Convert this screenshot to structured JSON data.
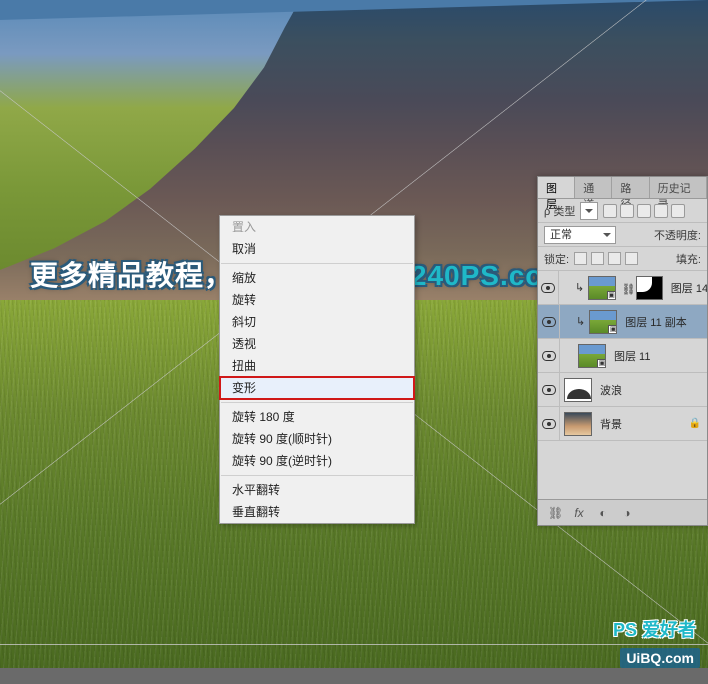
{
  "watermark": {
    "top_text": "更多精品教程，请访问",
    "url": "www.240PS.com",
    "ps_brand": "PS 爱好者",
    "uibq": "UiBQ.com"
  },
  "context_menu": {
    "items": [
      {
        "label": "置入",
        "disabled": true
      },
      {
        "label": "取消",
        "disabled": false
      },
      {
        "sep": true
      },
      {
        "label": "缩放",
        "disabled": false
      },
      {
        "label": "旋转",
        "disabled": false
      },
      {
        "label": "斜切",
        "disabled": false
      },
      {
        "label": "透视",
        "disabled": false
      },
      {
        "label": "扭曲",
        "disabled": false
      },
      {
        "label": "变形",
        "disabled": false,
        "highlight": true
      },
      {
        "sep": true
      },
      {
        "label": "旋转 180 度",
        "disabled": false
      },
      {
        "label": "旋转 90 度(顺时针)",
        "disabled": false
      },
      {
        "label": "旋转 90 度(逆时针)",
        "disabled": false
      },
      {
        "sep": true
      },
      {
        "label": "水平翻转",
        "disabled": false
      },
      {
        "label": "垂直翻转",
        "disabled": false
      }
    ]
  },
  "panel": {
    "tabs": [
      "图层",
      "通道",
      "路径",
      "历史记录"
    ],
    "active_tab": "图层",
    "filter_label_left": "ρ 类型",
    "blend_mode": "正常",
    "opacity_label": "不透明度:",
    "lock_label": "锁定:",
    "fill_label": "填充:",
    "layers": [
      {
        "name": "图层 14",
        "indent": true,
        "thumb": "img",
        "smart": true,
        "mask": true,
        "visible": true,
        "clip": true
      },
      {
        "name": "图层 11 副本",
        "indent": true,
        "thumb": "img",
        "smart": true,
        "mask": false,
        "visible": true,
        "selected": true,
        "clip": true
      },
      {
        "name": "图层 11",
        "indent": true,
        "thumb": "img",
        "smart": true,
        "mask": false,
        "visible": true,
        "clip": false
      },
      {
        "name": "波浪",
        "indent": false,
        "thumb": "wave",
        "smart": false,
        "mask": false,
        "visible": true,
        "clip": false
      },
      {
        "name": "背景",
        "indent": false,
        "thumb": "sky",
        "smart": false,
        "mask": false,
        "visible": true,
        "clip": false,
        "locked": true
      }
    ],
    "footer_icons": [
      "link",
      "fx",
      "mask",
      "adjust"
    ]
  }
}
